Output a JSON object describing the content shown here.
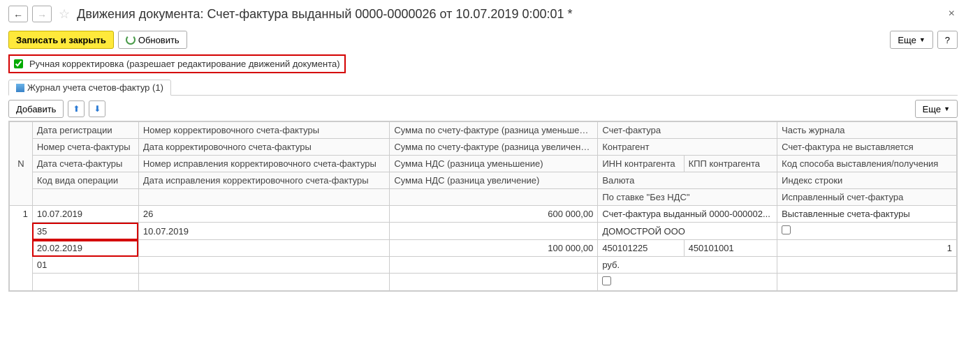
{
  "title": "Движения документа: Счет-фактура выданный 0000-0000026 от 10.07.2019 0:00:01 *",
  "toolbar": {
    "save_close": "Записать и закрыть",
    "refresh": "Обновить",
    "more": "Еще",
    "help": "?"
  },
  "manual_check": {
    "label": "Ручная корректировка (разрешает редактирование движений документа)",
    "checked": true
  },
  "tab": {
    "label": "Журнал учета счетов-фактур (1)"
  },
  "grid_toolbar": {
    "add": "Добавить",
    "more": "Еще"
  },
  "headers": {
    "n": "N",
    "r1c1": "Дата регистрации",
    "r2c1": "Номер счета-фактуры",
    "r3c1": "Дата счета-фактуры",
    "r4c1": "Код вида операции",
    "r1c2": "Номер корректировочного счета-фактуры",
    "r2c2": "Дата корректировочного счета-фактуры",
    "r3c2": "Номер исправления корректировочного счета-фактуры",
    "r4c2": "Дата исправления корректировочного счета-фактуры",
    "r1c3": "Сумма по счету-фактуре (разница уменьшение)",
    "r2c3": "Сумма по счету-фактуре (разница увеличение)",
    "r3c3": "Сумма НДС (разница уменьшение)",
    "r4c3": "Сумма НДС (разница увеличение)",
    "r1c4": "Счет-фактура",
    "r2c4": "Контрагент",
    "r3c4a": "ИНН контрагента",
    "r3c4b": "КПП контрагента",
    "r4c4": "Валюта",
    "r5c4": "По ставке \"Без НДС\"",
    "r1c5": "Часть журнала",
    "r2c5": "Счет-фактура не выставляется",
    "r3c5": "Код способа выставления/получения",
    "r4c5": "Индекс строки",
    "r5c5": "Исправленный счет-фактура"
  },
  "row": {
    "n": "1",
    "reg_date": "10.07.2019",
    "corr_num": "26",
    "sum_dec": "600 000,00",
    "invoice": "Счет-фактура выданный 0000-000002...",
    "journal_part": "Выставленные счета-фактуры",
    "inv_num": "35",
    "corr_date": "10.07.2019",
    "counterparty": "ДОМОСТРОЙ ООО",
    "inv_date": "20.02.2019",
    "vat_dec": "100 000,00",
    "inn": "450101225",
    "kpp": "450101001",
    "method_code": "1",
    "op_code": "01",
    "currency": "руб."
  }
}
